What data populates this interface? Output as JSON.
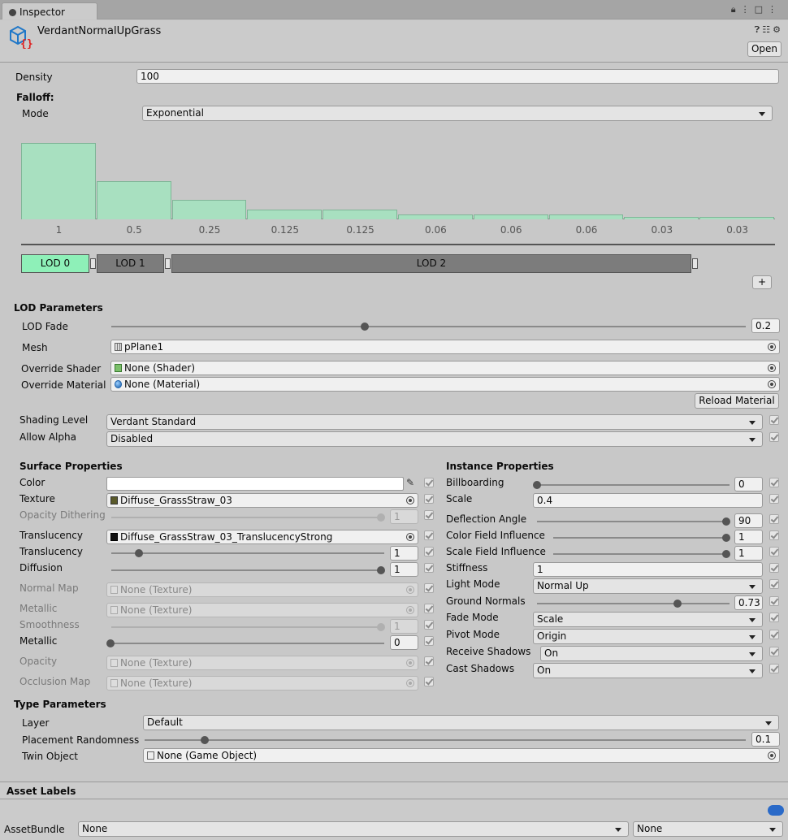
{
  "window": {
    "tab": "Inspector",
    "asset_name": "VerdantNormalUpGrass",
    "open_label": "Open"
  },
  "density": {
    "label": "Density",
    "value": "100"
  },
  "falloff": {
    "label": "Falloff:",
    "mode_label": "Mode",
    "mode_value": "Exponential",
    "bar_color": "#a8e0c0"
  },
  "chart_data": {
    "type": "bar",
    "categories": [
      "1",
      "0.5",
      "0.25",
      "0.125",
      "0.125",
      "0.06",
      "0.06",
      "0.06",
      "0.03",
      "0.03"
    ],
    "values": [
      1,
      0.5,
      0.25,
      0.125,
      0.125,
      0.06,
      0.06,
      0.06,
      0.03,
      0.03
    ],
    "ylim": [
      0,
      1
    ]
  },
  "lods": {
    "items": [
      {
        "label": "LOD 0",
        "color": "#8ef0b8"
      },
      {
        "label": "LOD 1",
        "color": "#7c7c7c"
      },
      {
        "label": "LOD 2",
        "color": "#7c7c7c"
      }
    ],
    "add_label": "+"
  },
  "lod_params": {
    "title": "LOD Parameters",
    "fade_label": "LOD Fade",
    "fade_value": "0.2",
    "fade_fraction": 0.4,
    "mesh_label": "Mesh",
    "mesh_value": "pPlane1",
    "shader_label": "Override Shader",
    "shader_value": "None (Shader)",
    "material_label": "Override Material",
    "material_value": "None (Material)",
    "reload_label": "Reload Material"
  },
  "shading": {
    "level_label": "Shading Level",
    "level_value": "Verdant Standard",
    "alpha_label": "Allow Alpha",
    "alpha_value": "Disabled"
  },
  "surface": {
    "title": "Surface Properties",
    "color_label": "Color",
    "texture_label": "Texture",
    "texture_value": "Diffuse_GrassStraw_03",
    "opacity_dither_label": "Opacity Dithering",
    "opacity_dither_value": "1",
    "translucency_tex_label": "Translucency",
    "translucency_tex_value": "Diffuse_GrassStraw_03_TranslucencyStrong",
    "translucency_label": "Translucency",
    "translucency_value": "1",
    "translucency_fraction": 0.1,
    "diffusion_label": "Diffusion",
    "diffusion_value": "1",
    "normal_label": "Normal Map",
    "normal_value": "None (Texture)",
    "metallic_tex_label": "Metallic",
    "metallic_tex_value": "None (Texture)",
    "smooth_label": "Smoothness",
    "smooth_value": "1",
    "metallic_label": "Metallic",
    "metallic_value": "0",
    "opacity_label": "Opacity",
    "opacity_value": "None (Texture)",
    "occlusion_label": "Occlusion Map",
    "occlusion_value": "None (Texture)"
  },
  "instance": {
    "title": "Instance Properties",
    "billboard_label": "Billboarding",
    "billboard_value": "0",
    "scale_label": "Scale",
    "scale_value": "0.4",
    "deflection_label": "Deflection Angle",
    "deflection_value": "90",
    "color_field_label": "Color Field Influence",
    "color_field_value": "1",
    "scale_field_label": "Scale Field Influence",
    "scale_field_value": "1",
    "stiffness_label": "Stiffness",
    "stiffness_value": "1",
    "light_label": "Light Mode",
    "light_value": "Normal Up",
    "ground_label": "Ground Normals",
    "ground_value": "0.73",
    "ground_fraction": 0.73,
    "fade_label": "Fade Mode",
    "fade_value": "Scale",
    "pivot_label": "Pivot Mode",
    "pivot_value": "Origin",
    "receive_label": "Receive Shadows",
    "receive_value": "On",
    "cast_label": "Cast Shadows",
    "cast_value": "On"
  },
  "type_params": {
    "title": "Type Parameters",
    "layer_label": "Layer",
    "layer_value": "Default",
    "rand_label": "Placement Randomness",
    "rand_value": "0.1",
    "rand_fraction": 0.1,
    "twin_label": "Twin Object",
    "twin_value": "None (Game Object)"
  },
  "footer": {
    "labels_title": "Asset Labels",
    "bundle_label": "AssetBundle",
    "bundle_value": "None",
    "variant_value": "None"
  }
}
